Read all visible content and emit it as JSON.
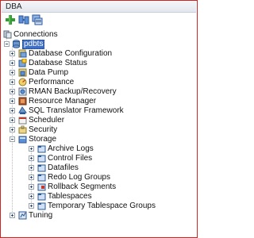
{
  "panel": {
    "title": "DBA"
  },
  "toolbar": {
    "buttons": [
      {
        "name": "add-connection-button",
        "icon": "green-plus-icon"
      },
      {
        "name": "refresh-button",
        "icon": "refresh-icon"
      },
      {
        "name": "filter-button",
        "icon": "filter-icon"
      }
    ]
  },
  "tree": {
    "root_label": "Connections",
    "connection_label": "pdbts",
    "items": [
      {
        "label": "Database Configuration",
        "icon": "database-config-icon"
      },
      {
        "label": "Database Status",
        "icon": "database-status-icon"
      },
      {
        "label": "Data Pump",
        "icon": "data-pump-icon"
      },
      {
        "label": "Performance",
        "icon": "performance-icon"
      },
      {
        "label": "RMAN Backup/Recovery",
        "icon": "rman-icon"
      },
      {
        "label": "Resource Manager",
        "icon": "resource-manager-icon"
      },
      {
        "label": "SQL Translator Framework",
        "icon": "sql-translator-icon"
      },
      {
        "label": "Scheduler",
        "icon": "scheduler-icon"
      },
      {
        "label": "Security",
        "icon": "security-icon"
      },
      {
        "label": "Storage",
        "icon": "storage-icon"
      }
    ],
    "storage_children": [
      {
        "label": "Archive Logs",
        "icon": "folder-icon"
      },
      {
        "label": "Control Files",
        "icon": "folder-icon"
      },
      {
        "label": "Datafiles",
        "icon": "folder-icon"
      },
      {
        "label": "Redo Log Groups",
        "icon": "folder-icon"
      },
      {
        "label": "Rollback Segments",
        "icon": "folder-icon"
      },
      {
        "label": "Tablespaces",
        "icon": "folder-icon"
      },
      {
        "label": "Temporary Tablespace Groups",
        "icon": "folder-icon"
      }
    ],
    "last_item": {
      "label": "Tuning",
      "icon": "tuning-icon"
    }
  },
  "colors": {
    "frame_border": "#d32020",
    "selection": "#3f6fc4"
  }
}
